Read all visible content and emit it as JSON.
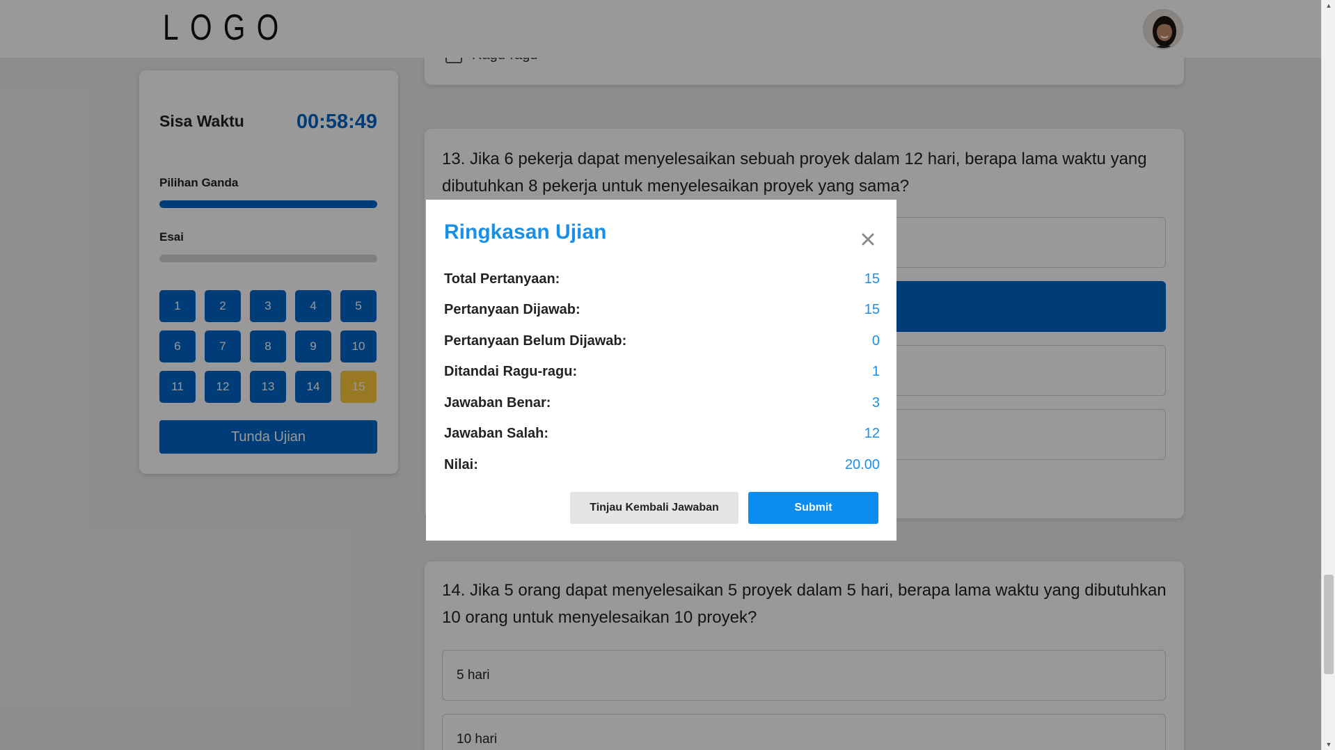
{
  "header": {
    "logo": "LOGO"
  },
  "sidebar": {
    "timer_label": "Sisa Waktu",
    "timer_value": "00:58:49",
    "sections": [
      {
        "label": "Pilihan Ganda",
        "progress": 1.0
      },
      {
        "label": "Esai",
        "progress": 0.0
      }
    ],
    "question_numbers": [
      "1",
      "2",
      "3",
      "4",
      "5",
      "6",
      "7",
      "8",
      "9",
      "10",
      "11",
      "12",
      "13",
      "14",
      "15"
    ],
    "flagged_question": "15",
    "colors": {
      "answered": "#0067c8",
      "flagged": "#ffc93c"
    },
    "pause_label": "Tunda Ujian"
  },
  "questions": {
    "q12_ragu_label": "Ragu-ragu",
    "q13": {
      "text": "13. Jika 6 pekerja dapat menyelesaikan sebuah proyek dalam 12 hari, berapa lama waktu yang dibutuhkan 8 pekerja untuk menyelesaikan proyek yang sama?",
      "selected_option_index": 1
    },
    "q14": {
      "text": "14. Jika 5 orang dapat menyelesaikan 5 proyek dalam 5 hari, berapa lama waktu yang dibutuhkan 10 orang untuk menyelesaikan 10 proyek?",
      "options": [
        "5 hari",
        "10 hari"
      ]
    }
  },
  "modal": {
    "title": "Ringkasan Ujian",
    "close_icon": "close-icon",
    "stats": [
      {
        "label": "Total Pertanyaan:",
        "value": "15"
      },
      {
        "label": "Pertanyaan Dijawab:",
        "value": "15"
      },
      {
        "label": "Pertanyaan Belum Dijawab:",
        "value": "0"
      },
      {
        "label": "Ditandai Ragu-ragu:",
        "value": "1"
      },
      {
        "label": "Jawaban Benar:",
        "value": "3"
      },
      {
        "label": "Jawaban Salah:",
        "value": "12"
      },
      {
        "label": "Nilai:",
        "value": "20.00"
      }
    ],
    "review_label": "Tinjau Kembali Jawaban",
    "submit_label": "Submit",
    "accent_color": "#1a8fe8"
  }
}
